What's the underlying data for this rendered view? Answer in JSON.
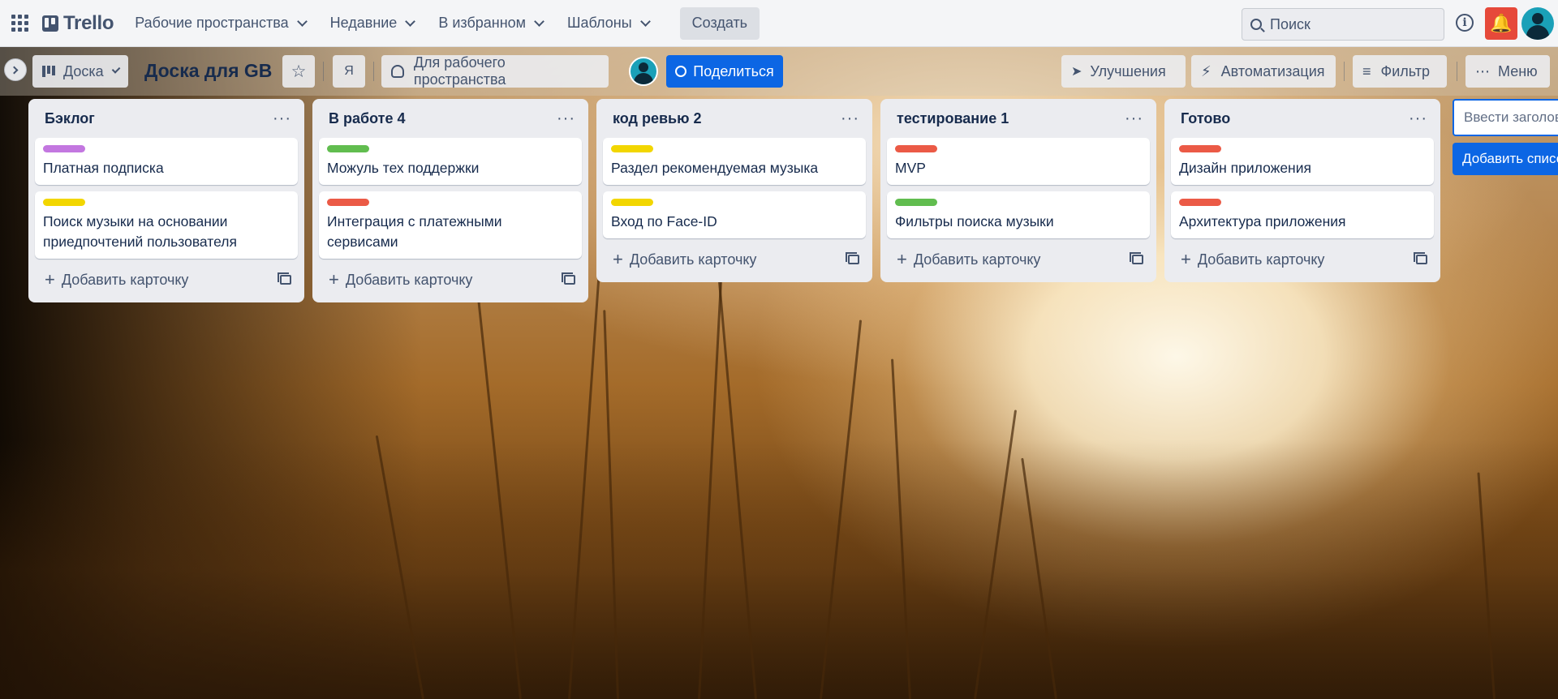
{
  "app": {
    "name": "Trello"
  },
  "topnav": {
    "items": [
      {
        "label": "Рабочие пространства"
      },
      {
        "label": "Недавние"
      },
      {
        "label": "В избранном"
      },
      {
        "label": "Шаблоны"
      }
    ],
    "create_label": "Создать",
    "search_placeholder": "Поиск"
  },
  "board": {
    "view_label": "Доска",
    "title": "Доска для GB",
    "member_initial": "Я",
    "workspace_label": "Для рабочего пространства",
    "share_label": "Поделиться",
    "powerups_label": "Улучшения",
    "automation_label": "Автоматизация",
    "filter_label": "Фильтр",
    "menu_label": "Меню"
  },
  "lists": [
    {
      "title": "Бэклог",
      "cards": [
        {
          "label_color": "#c377e0",
          "text": "Платная подписка"
        },
        {
          "label_color": "#f2d600",
          "text": "Поиск музыки на основании приедпочтений пользователя"
        }
      ],
      "add_label": "Добавить карточку"
    },
    {
      "title": "В работе 4",
      "cards": [
        {
          "label_color": "#61bd4f",
          "text": "Можуль тех поддержки"
        },
        {
          "label_color": "#eb5a46",
          "text": "Интеграция с платежными сервисами"
        }
      ],
      "add_label": "Добавить карточку"
    },
    {
      "title": "код ревью 2",
      "cards": [
        {
          "label_color": "#f2d600",
          "text": "Раздел рекомендуемая музыка"
        },
        {
          "label_color": "#f2d600",
          "text": "Вход по Face-ID"
        }
      ],
      "add_label": "Добавить карточку"
    },
    {
      "title": "тестирование 1",
      "cards": [
        {
          "label_color": "#eb5a46",
          "text": "MVP"
        },
        {
          "label_color": "#61bd4f",
          "text": "Фильтры поиска музыки"
        }
      ],
      "add_label": "Добавить карточку"
    },
    {
      "title": "Готово",
      "cards": [
        {
          "label_color": "#eb5a46",
          "text": "Дизайн приложения"
        },
        {
          "label_color": "#eb5a46",
          "text": "Архитектура приложения"
        }
      ],
      "add_label": "Добавить карточку"
    }
  ],
  "new_list": {
    "input_placeholder": "Ввести заголовок",
    "button_label": "Добавить список"
  }
}
